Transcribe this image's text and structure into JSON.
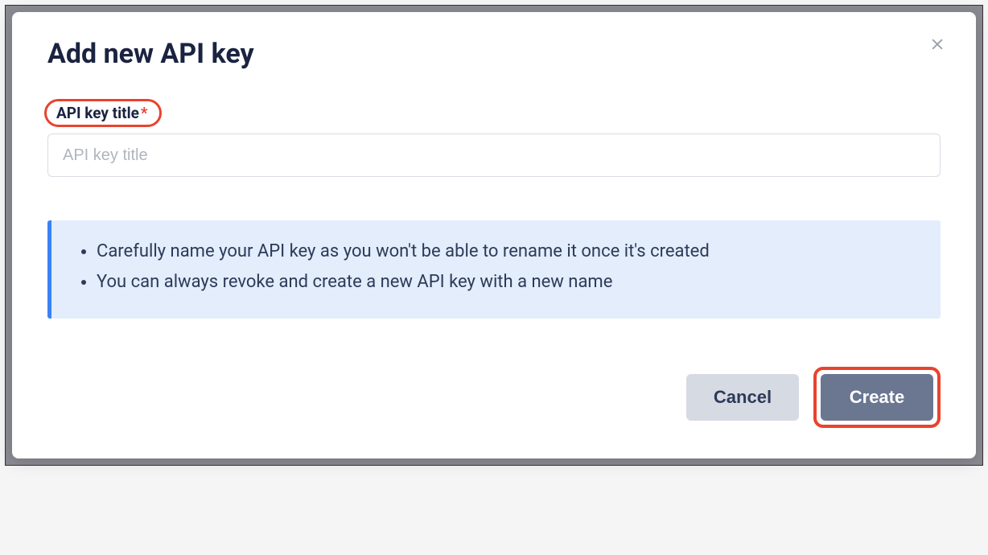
{
  "modal": {
    "title": "Add new API key",
    "close_icon": "close-icon",
    "field": {
      "label": "API key title",
      "required_mark": "*",
      "placeholder": "API key title",
      "value": ""
    },
    "info": {
      "items": [
        "Carefully name your API key as you won't be able to rename it once it's created",
        "You can always revoke and create a new API key with a new name"
      ]
    },
    "actions": {
      "cancel_label": "Cancel",
      "create_label": "Create"
    }
  },
  "highlights": {
    "label_outline_color": "#e8432e",
    "create_outline_color": "#e8432e"
  }
}
